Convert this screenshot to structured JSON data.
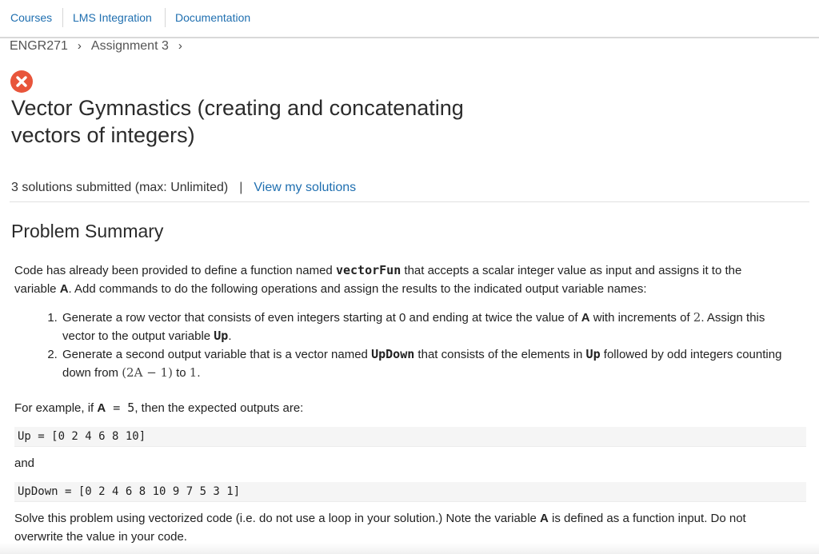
{
  "nav": {
    "courses": "Courses",
    "lms": "LMS Integration",
    "docs": "Documentation"
  },
  "breadcrumb": {
    "course": "ENGR271",
    "assignment": "Assignment 3",
    "separator": "›"
  },
  "status": {
    "icon": "error-x-icon",
    "color": "#e8553b"
  },
  "problem": {
    "title": "Vector Gymnastics (creating and concatenating vectors of integers)",
    "submitted": "3 solutions submitted (max: Unlimited)",
    "separator": "|",
    "view_link": "View my solutions"
  },
  "summary": {
    "heading": "Problem Summary",
    "intro": {
      "t1": "Code has already been provided to define a function named ",
      "fn": "vectorFun",
      "t2": " that accepts a scalar integer value as input and assigns it to the variable ",
      "var": "A",
      "t3": ".  Add commands to do the following operations and assign the results to the indicated output variable names:"
    },
    "steps": [
      {
        "t1": "Generate a row vector that consists of even integers starting at 0 and ending at twice the value of ",
        "var": "A",
        "t2": " with increments of ",
        "math": "2",
        "t3": ". Assign this vector to the output variable ",
        "out": "Up",
        "t4": "."
      },
      {
        "t1": "Generate a second output variable that is a vector named ",
        "out": "UpDown",
        "t2": " that consists of the elements in ",
        "ref": "Up",
        "t3": " followed by odd integers counting down from ",
        "math1": "(2A − 1)",
        "t4": " to ",
        "math2": "1",
        "t5": "."
      }
    ],
    "example": {
      "t1": "For example, if ",
      "var": "A",
      "eq": " = 5",
      "t2": ", then the expected outputs are:"
    },
    "code1": "Up = [0 2 4 6 8 10]",
    "and": "and",
    "code2": "UpDown = [0 2 4 6 8 10 9 7 5 3 1]",
    "note": {
      "t1": "Solve this problem using vectorized code (i.e. do not use a loop in your solution.)  Note the variable ",
      "var": "A",
      "t2": " is defined as a function input.  Do not overwrite the value in your code."
    }
  },
  "colors": {
    "link": "#1f6fb0",
    "error": "#e8553b",
    "code_bg": "#f5f5f5"
  }
}
